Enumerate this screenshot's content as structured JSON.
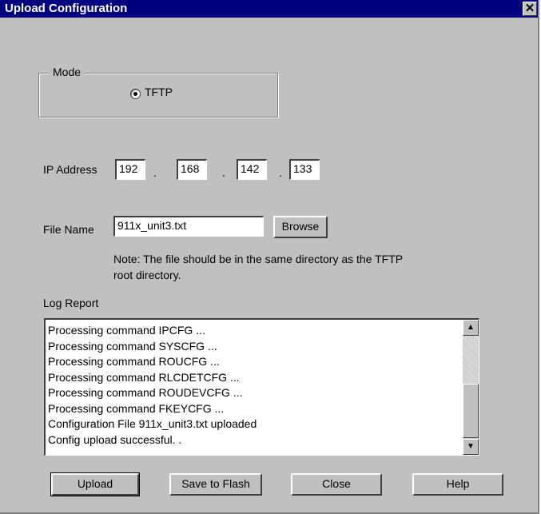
{
  "window": {
    "title": "Upload Configuration",
    "close_glyph": "✕"
  },
  "mode": {
    "legend": "Mode",
    "option_label": "TFTP",
    "selected": true
  },
  "ip": {
    "label": "IP Address",
    "octets": [
      "192",
      "168",
      "142",
      "133"
    ],
    "separator": "."
  },
  "file": {
    "label": "File Name",
    "value": "911x_unit3.txt",
    "browse_label": "Browse",
    "note_line1": "Note: The file should be in the same directory as the TFTP",
    "note_line2": "root directory."
  },
  "log": {
    "label": "Log Report",
    "lines": [
      "Processing command IPCFG ...",
      "Processing command SYSCFG ...",
      "Processing command ROUCFG ...",
      "Processing command RLCDETCFG ...",
      "Processing command ROUDEVCFG ...",
      "Processing command FKEYCFG ...",
      "Configuration File 911x_unit3.txt uploaded",
      "Config upload successful. ."
    ],
    "scroll_up_glyph": "▲",
    "scroll_down_glyph": "▼"
  },
  "buttons": {
    "upload": "Upload",
    "save_flash": "Save to Flash",
    "close": "Close",
    "help": "Help"
  },
  "colors": {
    "titlebar": "#000080",
    "face": "#c0c0c0"
  }
}
